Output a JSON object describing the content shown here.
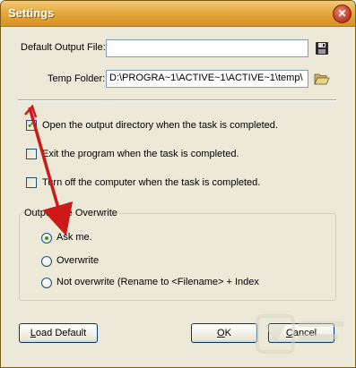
{
  "window": {
    "title": "Settings"
  },
  "fields": {
    "default_output_label": "Default Output File:",
    "default_output_value": "",
    "temp_folder_label": "Temp Folder:",
    "temp_folder_value": "D:\\PROGRA~1\\ACTIVE~1\\ACTIVE~1\\temp\\"
  },
  "options": {
    "open_output_dir": {
      "label": "Open the output directory when the task is completed.",
      "checked": true
    },
    "exit_program": {
      "label": "Exit the program when the task is completed.",
      "checked": false
    },
    "turn_off_computer": {
      "label": "Turn off the computer when the task is completed.",
      "checked": false
    }
  },
  "overwrite_group": {
    "title": "Output File Overwrite",
    "options": [
      {
        "label": "Ask me.",
        "selected": true
      },
      {
        "label": "Overwrite",
        "selected": false
      },
      {
        "label": "Not overwrite (Rename to <Filename> + Index",
        "selected": false
      }
    ]
  },
  "buttons": {
    "load_default_mn": "L",
    "load_default_rest": "oad Default",
    "ok_mn": "O",
    "ok_rest": "K",
    "cancel_mn": "C",
    "cancel_rest": "ancel"
  },
  "colors": {
    "titlebar": "#e6a93f",
    "dialog_bg": "#ece9d8",
    "accent_green": "#21a121",
    "annotation_red": "#cc1a1a"
  },
  "icons": {
    "save": "floppy-disk-icon",
    "browse": "open-folder-icon"
  }
}
